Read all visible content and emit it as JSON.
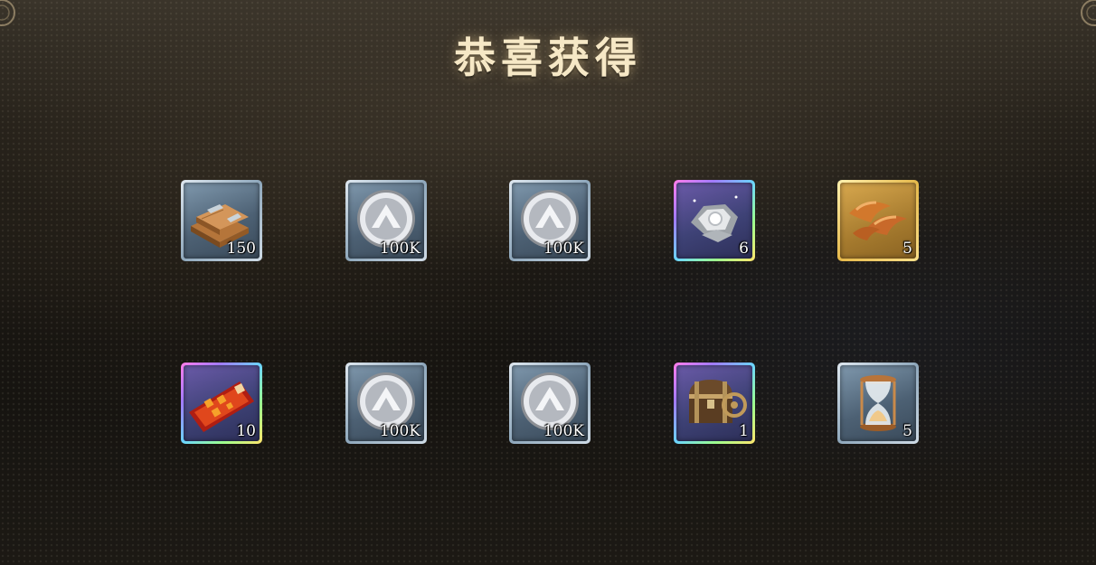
{
  "title": "恭喜获得",
  "rewards": [
    {
      "icon": "wood-plank-icon",
      "qty": "150",
      "rarity": "silver"
    },
    {
      "icon": "silver-coin-icon",
      "qty": "100K",
      "rarity": "silver"
    },
    {
      "icon": "silver-coin-icon",
      "qty": "100K",
      "rarity": "silver"
    },
    {
      "icon": "crystal-ore-icon",
      "qty": "6",
      "rarity": "rainbow"
    },
    {
      "icon": "croissant-icon",
      "qty": "5",
      "rarity": "gold"
    },
    {
      "icon": "ticket-icon",
      "qty": "10",
      "rarity": "rainbow"
    },
    {
      "icon": "silver-coin-icon",
      "qty": "100K",
      "rarity": "silver"
    },
    {
      "icon": "silver-coin-icon",
      "qty": "100K",
      "rarity": "silver"
    },
    {
      "icon": "treasure-chest-icon",
      "qty": "1",
      "rarity": "rainbow"
    },
    {
      "icon": "hourglass-icon",
      "qty": "5",
      "rarity": "silver"
    }
  ]
}
